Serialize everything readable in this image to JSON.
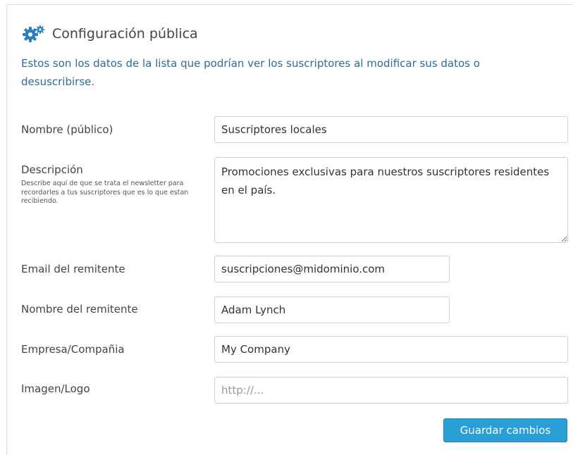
{
  "section": {
    "icon": "gears-icon",
    "title": "Configuración pública",
    "intro": "Estos son los datos de la lista que podrían ver los suscriptores al modificar sus datos o desuscribirse."
  },
  "form": {
    "public_name": {
      "label": "Nombre (público)",
      "value": "Suscriptores locales"
    },
    "description": {
      "label": "Descripción",
      "hint": "Describe aquí de que se trata el newsletter para recordarles a tus suscriptores que es lo que estan recibiendo.",
      "value": "Promociones exclusivas para nuestros suscriptores residentes en el país."
    },
    "sender_email": {
      "label": "Email del remitente",
      "value": "suscripciones@midominio.com"
    },
    "sender_name": {
      "label": "Nombre del remitente",
      "value": "Adam Lynch"
    },
    "company": {
      "label": "Empresa/Compañia",
      "value": "My Company"
    },
    "logo": {
      "label": "Imagen/Logo",
      "value": "",
      "placeholder": "http://..."
    }
  },
  "actions": {
    "save_label": "Guardar cambios"
  },
  "colors": {
    "accent": "#2a9fd6",
    "intro_text": "#2b6d9c",
    "icon": "#2a7fc0"
  }
}
